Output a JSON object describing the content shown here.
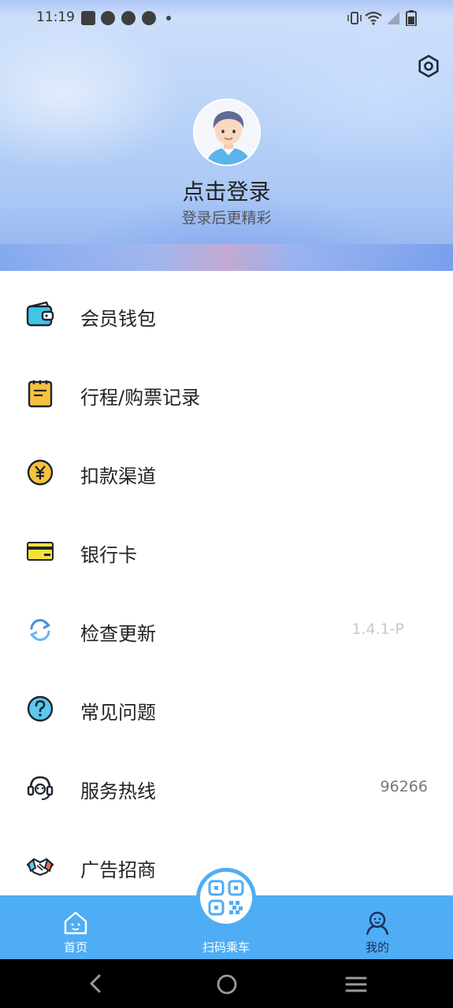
{
  "status_bar": {
    "time": "11:19",
    "notification_icons": [
      "mail-icon",
      "compass-icon",
      "compass-icon",
      "compass-icon"
    ],
    "right_icons": [
      "vibrate-icon",
      "wifi-icon",
      "signal-icon",
      "battery-icon"
    ]
  },
  "profile": {
    "login_title": "点击登录",
    "login_subtitle": "登录后更精彩"
  },
  "menu": [
    {
      "label": "会员钱包",
      "icon": "wallet-icon"
    },
    {
      "label": "行程/购票记录",
      "icon": "notebook-icon"
    },
    {
      "label": "扣款渠道",
      "icon": "yuan-coin-icon"
    },
    {
      "label": "银行卡",
      "icon": "bank-card-icon"
    },
    {
      "label": "检查更新",
      "icon": "refresh-icon",
      "value": "1.4.1-P"
    },
    {
      "label": "常见问题",
      "icon": "question-icon"
    },
    {
      "label": "服务热线",
      "icon": "headset-icon",
      "value": "96266"
    },
    {
      "label": "广告招商",
      "icon": "handshake-icon"
    }
  ],
  "tabbar": {
    "home_label": "首页",
    "scan_label": "扫码乘车",
    "mine_label": "我的"
  },
  "colors": {
    "accent": "#4fadf5",
    "header_blue": "#a9c6f4"
  }
}
